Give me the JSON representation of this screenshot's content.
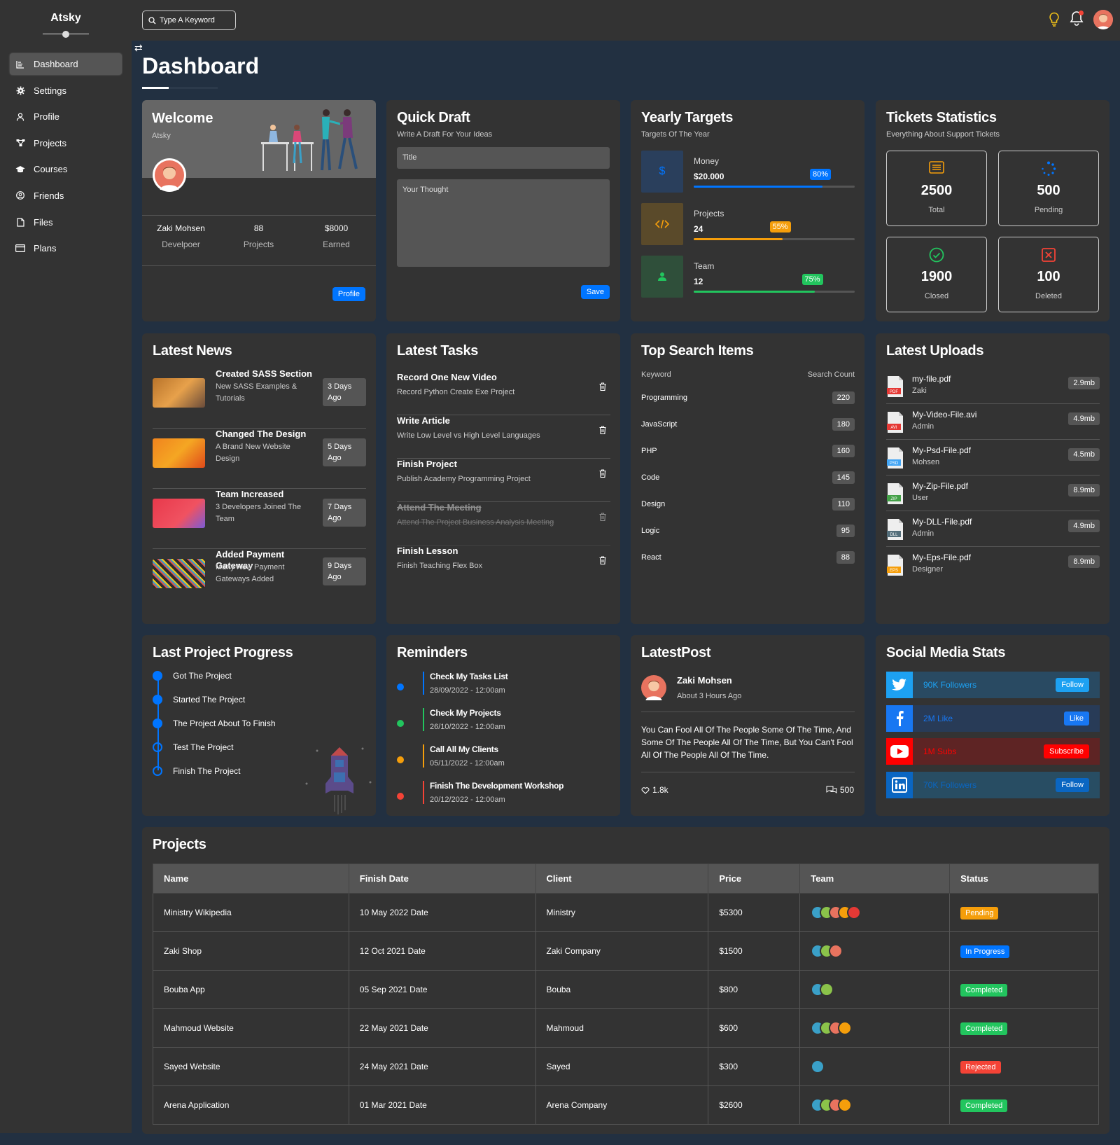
{
  "app": {
    "logo": "Atsky"
  },
  "sidebar": {
    "items": [
      {
        "label": "Dashboard",
        "icon": "chart-icon"
      },
      {
        "label": "Settings",
        "icon": "gear-icon"
      },
      {
        "label": "Profile",
        "icon": "user-icon"
      },
      {
        "label": "Projects",
        "icon": "diagram-icon"
      },
      {
        "label": "Courses",
        "icon": "graduation-cap-icon"
      },
      {
        "label": "Friends",
        "icon": "user-circle-icon"
      },
      {
        "label": "Files",
        "icon": "file-icon"
      },
      {
        "label": "Plans",
        "icon": "credit-card-icon"
      }
    ]
  },
  "topbar": {
    "search_placeholder": "Type A Keyword"
  },
  "page": {
    "title": "Dashboard"
  },
  "welcome": {
    "title": "Welcome",
    "subtitle": "Atsky",
    "stats": [
      {
        "value": "Zaki Mohsen",
        "label": "Develpoer"
      },
      {
        "value": "88",
        "label": "Projects"
      },
      {
        "value": "$8000",
        "label": "Earned"
      }
    ],
    "button": "Profile"
  },
  "quick_draft": {
    "title": "Quick Draft",
    "subtitle": "Write A Draft For Your Ideas",
    "title_placeholder": "Title",
    "body_placeholder": "Your Thought",
    "button": "Save"
  },
  "yearly_targets": {
    "title": "Yearly Targets",
    "subtitle": "Targets Of The Year",
    "items": [
      {
        "label": "Money",
        "value": "$20.000",
        "progress": 80,
        "progress_label": "80%",
        "color": "#0075ff",
        "icon": "dollar-icon"
      },
      {
        "label": "Projects",
        "value": "24",
        "progress": 55,
        "progress_label": "55%",
        "color": "#f59e0b",
        "icon": "code-icon"
      },
      {
        "label": "Team",
        "value": "12",
        "progress": 75,
        "progress_label": "75%",
        "color": "#22c55e",
        "icon": "user-icon"
      }
    ]
  },
  "tickets": {
    "title": "Tickets Statistics",
    "subtitle": "Everything About Support Tickets",
    "items": [
      {
        "value": "2500",
        "label": "Total",
        "color": "#f59e0b"
      },
      {
        "value": "500",
        "label": "Pending",
        "color": "#0075ff"
      },
      {
        "value": "1900",
        "label": "Closed",
        "color": "#22c55e"
      },
      {
        "value": "100",
        "label": "Deleted",
        "color": "#f44336"
      }
    ]
  },
  "news": {
    "title": "Latest News",
    "items": [
      {
        "title": "Created SASS Section",
        "desc": "New SASS Examples & Tutorials",
        "badge": "3 Days Ago"
      },
      {
        "title": "Changed The Design",
        "desc": "A Brand New Website Design",
        "badge": "5 Days Ago"
      },
      {
        "title": "Team Increased",
        "desc": "3 Developers Joined The Team",
        "badge": "7 Days Ago"
      },
      {
        "title": "Added Payment Gateway",
        "desc": "Many New Payment Gateways Added",
        "badge": "9 Days Ago"
      }
    ]
  },
  "tasks": {
    "title": "Latest Tasks",
    "items": [
      {
        "title": "Record One New Video",
        "desc": "Record Python Create Exe Project",
        "done": false
      },
      {
        "title": "Write Article",
        "desc": "Write Low Level vs High Level Languages",
        "done": false
      },
      {
        "title": "Finish Project",
        "desc": "Publish Academy Programming Project",
        "done": false
      },
      {
        "title": "Attend The Meeting",
        "desc": "Attend The Project Business Analysis Meeting",
        "done": true
      },
      {
        "title": "Finish Lesson",
        "desc": "Finish Teaching Flex Box",
        "done": false
      }
    ]
  },
  "search_items": {
    "title": "Top Search Items",
    "col_keyword": "Keyword",
    "col_count": "Search Count",
    "items": [
      {
        "keyword": "Programming",
        "count": "220"
      },
      {
        "keyword": "JavaScript",
        "count": "180"
      },
      {
        "keyword": "PHP",
        "count": "160"
      },
      {
        "keyword": "Code",
        "count": "145"
      },
      {
        "keyword": "Design",
        "count": "110"
      },
      {
        "keyword": "Logic",
        "count": "95"
      },
      {
        "keyword": "React",
        "count": "88"
      }
    ]
  },
  "uploads": {
    "title": "Latest Uploads",
    "items": [
      {
        "name": "my-file.pdf",
        "owner": "Zaki",
        "size": "2.9mb",
        "ext": "PDF",
        "color": "#e53935"
      },
      {
        "name": "My-Video-File.avi",
        "owner": "Admin",
        "size": "4.9mb",
        "ext": "AVI",
        "color": "#e53935"
      },
      {
        "name": "My-Psd-File.pdf",
        "owner": "Mohsen",
        "size": "4.5mb",
        "ext": "PSD",
        "color": "#42a5f5"
      },
      {
        "name": "My-Zip-File.pdf",
        "owner": "User",
        "size": "8.9mb",
        "ext": "ZIP",
        "color": "#43a047"
      },
      {
        "name": "My-DLL-File.pdf",
        "owner": "Admin",
        "size": "4.9mb",
        "ext": "DLL",
        "color": "#546e7a"
      },
      {
        "name": "My-Eps-File.pdf",
        "owner": "Designer",
        "size": "8.9mb",
        "ext": "EPS",
        "color": "#f59e0b"
      }
    ]
  },
  "progress": {
    "title": "Last Project Progress",
    "steps": [
      {
        "label": "Got The Project",
        "done": true
      },
      {
        "label": "Started The Project",
        "done": true
      },
      {
        "label": "The Project About To Finish",
        "done": true
      },
      {
        "label": "Test The Project",
        "done": false
      },
      {
        "label": "Finish The Project",
        "done": false
      }
    ]
  },
  "reminders": {
    "title": "Reminders",
    "items": [
      {
        "title": "Check My Tasks List",
        "date": "28/09/2022 - 12:00am",
        "color": "#0075ff"
      },
      {
        "title": "Check My Projects",
        "date": "26/10/2022 - 12:00am",
        "color": "#22c55e"
      },
      {
        "title": "Call All My Clients",
        "date": "05/11/2022 - 12:00am",
        "color": "#f59e0b"
      },
      {
        "title": "Finish The Development Workshop",
        "date": "20/12/2022 - 12:00am",
        "color": "#f44336"
      }
    ]
  },
  "latest_post": {
    "title": "LatestPost",
    "author": "Zaki Mohsen",
    "time": "About 3 Hours Ago",
    "text": "You Can Fool All Of The People Some Of The Time, And Some Of The People All Of The Time, But You Can't Fool All Of The People All Of The Time.",
    "likes": "1.8k",
    "comments": "500"
  },
  "social": {
    "title": "Social Media Stats",
    "items": [
      {
        "label": "90K Followers",
        "button": "Follow",
        "color": "#1da1f2",
        "bg": "#294a62",
        "icon": "twitter-icon"
      },
      {
        "label": "2M Like",
        "button": "Like",
        "color": "#1877f2",
        "bg": "#283b57",
        "icon": "facebook-icon"
      },
      {
        "label": "1M Subs",
        "button": "Subscribe",
        "color": "#ff0000",
        "bg": "#5e2424",
        "icon": "youtube-icon"
      },
      {
        "label": "70K Followers",
        "button": "Follow",
        "color": "#0a66c2",
        "bg": "#284d63",
        "icon": "linkedin-icon"
      }
    ]
  },
  "projects": {
    "title": "Projects",
    "headers": [
      "Name",
      "Finish Date",
      "Client",
      "Price",
      "Team",
      "Status"
    ],
    "rows": [
      {
        "name": "Ministry Wikipedia",
        "date": "10 May 2022 Date",
        "client": "Ministry",
        "price": "$5300",
        "team": 5,
        "status": "Pending",
        "status_color": "#f59e0b"
      },
      {
        "name": "Zaki Shop",
        "date": "12 Oct 2021 Date",
        "client": "Zaki Company",
        "price": "$1500",
        "team": 3,
        "status": "In Progress",
        "status_color": "#0075ff"
      },
      {
        "name": "Bouba App",
        "date": "05 Sep 2021 Date",
        "client": "Bouba",
        "price": "$800",
        "team": 2,
        "status": "Completed",
        "status_color": "#22c55e"
      },
      {
        "name": "Mahmoud Website",
        "date": "22 May 2021 Date",
        "client": "Mahmoud",
        "price": "$600",
        "team": 4,
        "status": "Completed",
        "status_color": "#22c55e"
      },
      {
        "name": "Sayed Website",
        "date": "24 May 2021 Date",
        "client": "Sayed",
        "price": "$300",
        "team": 1,
        "status": "Rejected",
        "status_color": "#f44336"
      },
      {
        "name": "Arena Application",
        "date": "01 Mar 2021 Date",
        "client": "Arena Company",
        "price": "$2600",
        "team": 4,
        "status": "Completed",
        "status_color": "#22c55e"
      }
    ]
  }
}
